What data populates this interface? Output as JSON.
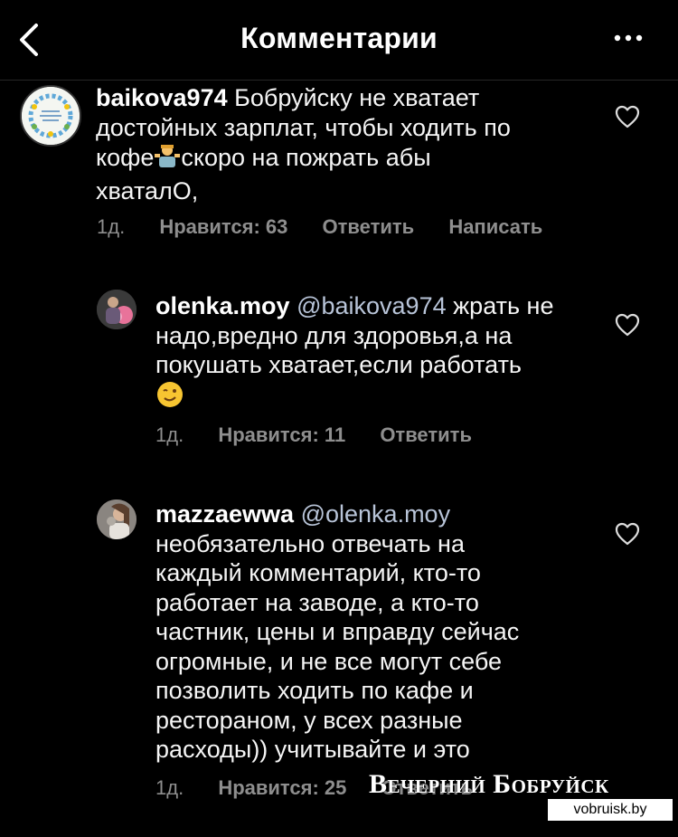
{
  "header": {
    "title": "Комментарии"
  },
  "comments": [
    {
      "username": "baikova974",
      "lines": [
        "Бобруйску не хватает",
        "достойных зарплат, чтобы ходить по",
        "кофе",
        "скоро на пожрать абы",
        "хваталО,"
      ],
      "time": "1д.",
      "likes": "Нравится: 63",
      "reply": "Ответить",
      "send": "Написать"
    },
    {
      "username": "olenka.moy",
      "mention": "@baikova974",
      "lines": [
        "жрать не",
        "надо,вредно для здоровья,а на",
        "покушать хватает,если работать"
      ],
      "time": "1д.",
      "likes": "Нравится: 11",
      "reply": "Ответить"
    },
    {
      "username": "mazzaewwa",
      "mention": "@olenka.moy",
      "lines": [
        "необязательно отвечать на",
        "каждый комментарий, кто-то",
        "работает на заводе, а кто-то",
        "частник, цены и вправду сейчас",
        "огромные, и не все могут себе",
        "позволить ходить по кафе и",
        "ресторaном, у всех разные",
        "расходы)) учитывайте и это"
      ],
      "time": "1д.",
      "likes": "Нравится: 25",
      "reply": "Ответить"
    }
  ],
  "watermark": {
    "name": "Вечерний Бобруйск",
    "url": "vobruisk.by"
  }
}
